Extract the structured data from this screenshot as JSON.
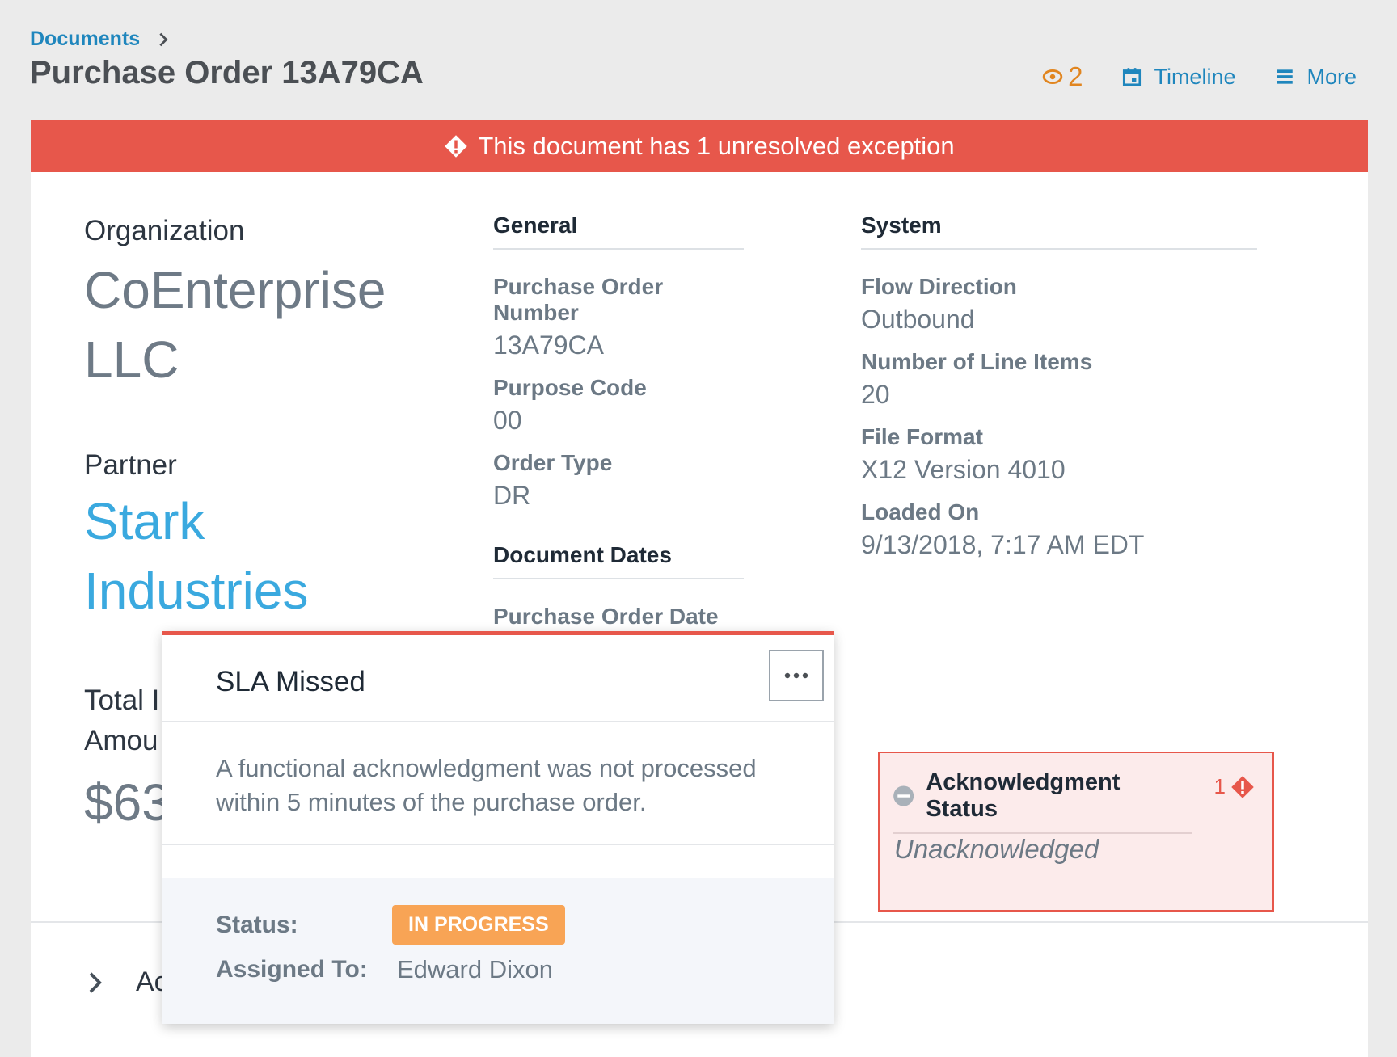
{
  "breadcrumb": {
    "parent": "Documents"
  },
  "page": {
    "title": "Purchase Order 13A79CA"
  },
  "header_actions": {
    "watchers_count": "2",
    "timeline_label": "Timeline",
    "more_label": "More"
  },
  "banner": {
    "message": "This document has 1 unresolved exception"
  },
  "overview": {
    "organization_label": "Organization",
    "organization_name_line1": "CoEnterprise",
    "organization_name_line2": "LLC",
    "partner_label": "Partner",
    "partner_name_line1": "Stark",
    "partner_name_line2": "Industries",
    "total_label_line1": "Total I",
    "total_label_line2": "Amou",
    "total_value": "$63"
  },
  "general": {
    "heading": "General",
    "fields": [
      {
        "label": "Purchase Order Number",
        "value": "13A79CA"
      },
      {
        "label": "Purpose Code",
        "value": "00"
      },
      {
        "label": "Order Type",
        "value": "DR"
      }
    ]
  },
  "document_dates": {
    "heading": "Document Dates",
    "fields": [
      {
        "label": "Purchase Order Date"
      }
    ]
  },
  "system": {
    "heading": "System",
    "fields": [
      {
        "label": "Flow Direction",
        "value": "Outbound"
      },
      {
        "label": "Number of Line Items",
        "value": "20"
      },
      {
        "label": "File Format",
        "value": "X12 Version 4010"
      },
      {
        "label": "Loaded On",
        "value": "9/13/2018, 7:17 AM EDT"
      }
    ]
  },
  "acknowledgment": {
    "title": "Acknowledgment Status",
    "exception_count": "1",
    "value": "Unacknowledged"
  },
  "expand_section": {
    "label_partial": "Ac"
  },
  "exception_popover": {
    "title": "SLA Missed",
    "description": "A functional acknowledgment was not processed within 5 minutes of the purchase order.",
    "status_label": "Status:",
    "status_value": "IN PROGRESS",
    "assigned_label": "Assigned To:",
    "assigned_value": "Edward Dixon"
  },
  "colors": {
    "accent_blue": "#1f86bd",
    "partner_blue": "#3aa9df",
    "error_red": "#e7574b",
    "watch_orange": "#e1851f",
    "status_orange": "#f8a455"
  }
}
